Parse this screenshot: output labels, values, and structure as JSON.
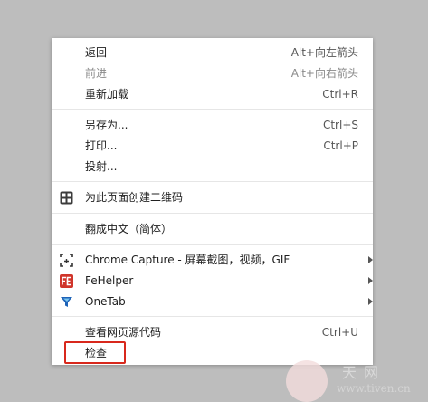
{
  "menu": {
    "groups": [
      [
        {
          "label": "返回",
          "shortcut": "Alt+向左箭头",
          "disabled": false
        },
        {
          "label": "前进",
          "shortcut": "Alt+向右箭头",
          "disabled": true
        },
        {
          "label": "重新加载",
          "shortcut": "Ctrl+R",
          "disabled": false
        }
      ],
      [
        {
          "label": "另存为...",
          "shortcut": "Ctrl+S"
        },
        {
          "label": "打印...",
          "shortcut": "Ctrl+P"
        },
        {
          "label": "投射..."
        }
      ],
      [
        {
          "label": "为此页面创建二维码",
          "icon": "qr-code-icon"
        }
      ],
      [
        {
          "label": "翻成中文（简体）"
        }
      ],
      [
        {
          "label": "Chrome Capture - 屏幕截图，视频，GIF",
          "icon": "capture-crop-icon",
          "submenu": true
        },
        {
          "label": "FeHelper",
          "icon": "fehelper-icon",
          "submenu": true
        },
        {
          "label": "OneTab",
          "icon": "onetab-funnel-icon",
          "submenu": true
        }
      ],
      [
        {
          "label": "查看网页源代码",
          "shortcut": "Ctrl+U"
        },
        {
          "label": "检查",
          "highlighted": true
        }
      ]
    ]
  },
  "watermark": {
    "line1": "天网",
    "line2": "www.tiven.cn"
  },
  "colors": {
    "highlight": "#d8281c",
    "fehelper": "#d0352b",
    "onetab": "#1e63b8"
  }
}
